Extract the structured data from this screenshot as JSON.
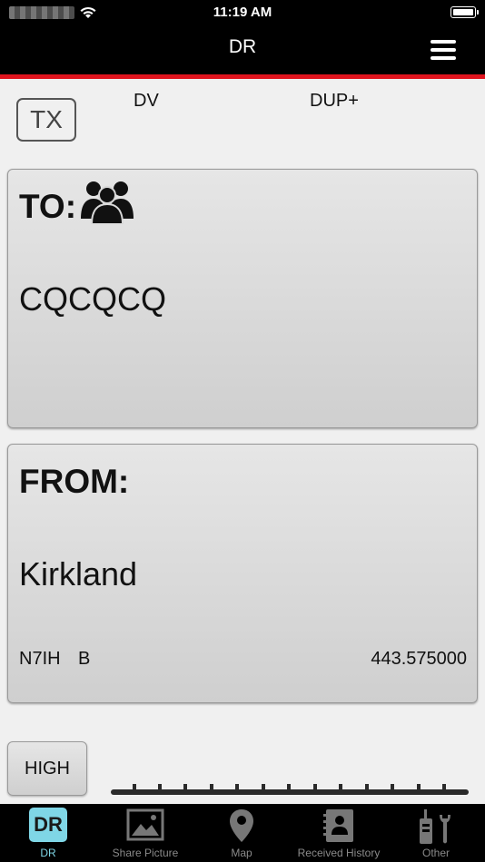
{
  "status_bar": {
    "time": "11:19 AM"
  },
  "header": {
    "title": "DR",
    "menu_icon": "hamburger-menu-icon"
  },
  "controls": {
    "tx_label": "TX",
    "mode": "DV",
    "duplex": "DUP+"
  },
  "to_panel": {
    "label": "TO:",
    "icon": "group-icon",
    "callsign": "CQCQCQ"
  },
  "from_panel": {
    "label": "FROM:",
    "repeater": "Kirkland",
    "callsign": "N7IH",
    "module": "B",
    "frequency": "443.575000"
  },
  "power": {
    "label": "HIGH"
  },
  "colors": {
    "accent": "#7fd6e6",
    "red_line": "#e0141e"
  },
  "tabs": [
    {
      "label": "DR",
      "icon": "dr-icon",
      "active": true
    },
    {
      "label": "Share Picture",
      "icon": "picture-icon"
    },
    {
      "label": "Map",
      "icon": "map-pin-icon"
    },
    {
      "label": "Received History",
      "icon": "contacts-book-icon"
    },
    {
      "label": "Other",
      "icon": "radio-wrench-icon"
    }
  ]
}
